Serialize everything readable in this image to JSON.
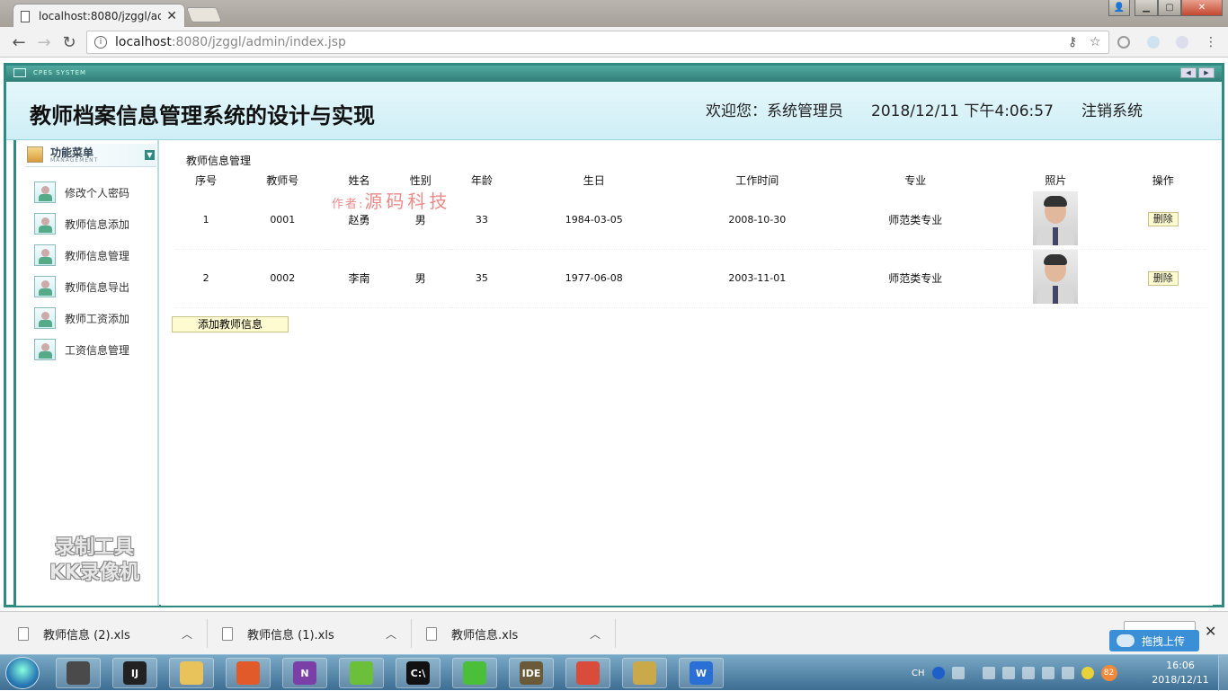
{
  "browser": {
    "tab_title": "localhost:8080/jzggl/ad",
    "url_host": "localhost",
    "url_rest": ":8080/jzggl/admin/index.jsp"
  },
  "app": {
    "system_label": "CPES SYSTEM",
    "title": "教师档案信息管理系统的设计与实现",
    "welcome": "欢迎您：系统管理员",
    "datetime": "2018/12/11 下午4:06:57",
    "logout": "注销系统"
  },
  "sidebar": {
    "menu_title": "功能菜单",
    "menu_subtitle": "MANAGEMENT",
    "items": [
      {
        "label": "修改个人密码"
      },
      {
        "label": "教师信息添加"
      },
      {
        "label": "教师信息管理"
      },
      {
        "label": "教师信息导出"
      },
      {
        "label": "教师工资添加"
      },
      {
        "label": "工资信息管理"
      }
    ]
  },
  "overlay": {
    "recorder_line1": "录制工具",
    "recorder_line2": "KK录像机",
    "author_label": "作者:",
    "author_name": "源码科技"
  },
  "main": {
    "title": "教师信息管理",
    "columns": [
      "序号",
      "教师号",
      "姓名",
      "性别",
      "年龄",
      "生日",
      "工作时间",
      "专业",
      "照片",
      "操作"
    ],
    "rows": [
      {
        "no": "1",
        "id": "0001",
        "name": "赵勇",
        "gender": "男",
        "age": "33",
        "birthday": "1984-03-05",
        "work_date": "2008-10-30",
        "major": "师范类专业",
        "action": "删除"
      },
      {
        "no": "2",
        "id": "0002",
        "name": "李南",
        "gender": "男",
        "age": "35",
        "birthday": "1977-06-08",
        "work_date": "2003-11-01",
        "major": "师范类专业",
        "action": "删除"
      }
    ],
    "add_button": "添加教师信息"
  },
  "downloads": {
    "items": [
      {
        "name": "教师信息 (2).xls"
      },
      {
        "name": "教师信息 (1).xls"
      },
      {
        "name": "教师信息.xls"
      }
    ],
    "upload_tip": "拖拽上传"
  },
  "taskbar": {
    "apps": [
      {
        "name": "user-app-icon",
        "color": "#4a4a4a",
        "glyph": ""
      },
      {
        "name": "intellij-icon",
        "color": "#222222",
        "glyph": "IJ"
      },
      {
        "name": "file-explorer-icon",
        "color": "#e8c25a",
        "glyph": ""
      },
      {
        "name": "recorder-app-icon",
        "color": "#e05a2a",
        "glyph": ""
      },
      {
        "name": "onenote-icon",
        "color": "#7b3fa8",
        "glyph": "N"
      },
      {
        "name": "green-app-icon",
        "color": "#6cbf3a",
        "glyph": ""
      },
      {
        "name": "cmd-icon",
        "color": "#111111",
        "glyph": "C:\\"
      },
      {
        "name": "wechat-icon",
        "color": "#4bbf3a",
        "glyph": ""
      },
      {
        "name": "javaee-ide-icon",
        "color": "#6a5a3a",
        "glyph": "IDE"
      },
      {
        "name": "chrome-icon",
        "color": "#d94b3a",
        "glyph": ""
      },
      {
        "name": "tools-icon",
        "color": "#c9a94a",
        "glyph": ""
      },
      {
        "name": "wps-icon",
        "color": "#2a6fd6",
        "glyph": "W"
      }
    ],
    "tray_lang": "CH",
    "tray_badge": "82",
    "clock_time": "16:06",
    "clock_date": "2018/12/11"
  }
}
